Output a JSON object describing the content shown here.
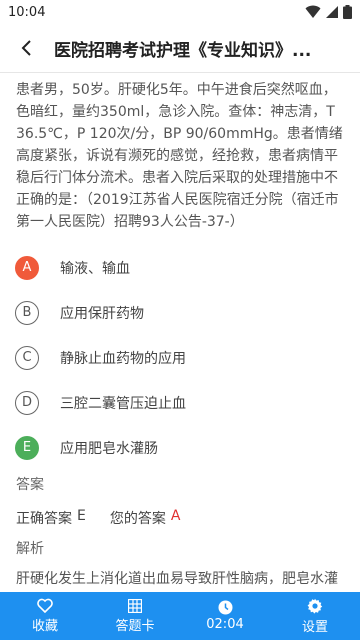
{
  "status_bar": {
    "time": "10:04"
  },
  "header": {
    "title": "医院招聘考试护理《专业知识》..."
  },
  "question": {
    "text": "患者男，50岁。肝硬化5年。中午进食后突然呕血，色暗红，量约350ml，急诊入院。查体：神志清，T 36.5℃，P 120次/分，BP 90/60mmHg。患者情绪高度紧张，诉说有濒死的感觉，经抢救，患者病情平稳后行门体分流术。患者入院后采取的处理措施中不正确的是：（2019江苏省人民医院宿迁分院（宿迁市第一人民医院）招聘93人公告-37-）"
  },
  "options": [
    {
      "letter": "A",
      "text": "输液、输血",
      "state": "wrong"
    },
    {
      "letter": "B",
      "text": "应用保肝药物",
      "state": "normal"
    },
    {
      "letter": "C",
      "text": "静脉止血药物的应用",
      "state": "normal"
    },
    {
      "letter": "D",
      "text": "三腔二囊管压迫止血",
      "state": "normal"
    },
    {
      "letter": "E",
      "text": "应用肥皂水灌肠",
      "state": "right"
    }
  ],
  "answer": {
    "section_label": "答案",
    "correct_label": "正确答案",
    "correct_value": "E",
    "yours_label": "您的答案",
    "yours_value": "A"
  },
  "explanation": {
    "label": "解析",
    "text": "肝硬化发生上消化道出血易导致肝性脑病，肥皂水灌肠会增加氨的产生和吸收，诱发肝性脑病发作。"
  },
  "bottom_bar": {
    "favorite": "收藏",
    "answer_card": "答题卡",
    "timer": "02:04",
    "settings": "设置"
  },
  "colors": {
    "accent": "#1e90f0",
    "wrong": "#f05a3a",
    "right": "#4cae5a"
  }
}
